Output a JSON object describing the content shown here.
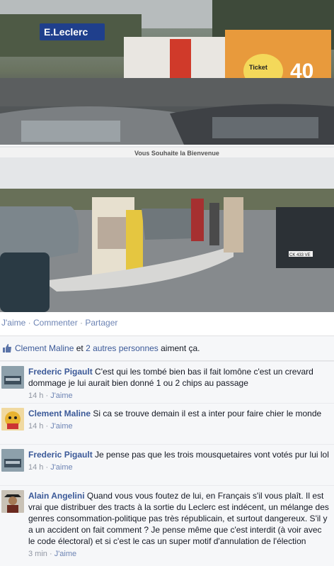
{
  "photos": {
    "photo1": {
      "store_sign": "E.Leclerc",
      "truck_text": "Ticket Leclerc",
      "truck_number": "40"
    },
    "photo2": {
      "banner_text": "Vous Souhaite la Bienvenue",
      "plate": "CK 433 VE"
    }
  },
  "post_actions": {
    "like": "J'aime",
    "comment": "Commenter",
    "share": "Partager"
  },
  "likes": {
    "name": "Clement Maline",
    "conj": " et ",
    "others": "2 autres personnes",
    "suffix": " aiment ça."
  },
  "comments": [
    {
      "author": "Frederic Pigault",
      "text": "C'est qui les tombé bien bas il fait lomône c'est un crevard dommage je lui aurait bien donné 1 ou 2 chips au passage",
      "time": "14 h",
      "like": "J'aime"
    },
    {
      "author": "Clement Maline",
      "text": "Si ca se trouve demain il est a inter pour faire chier le monde",
      "time": "14 h",
      "like": "J'aime"
    },
    {
      "author": "Frederic Pigault",
      "text": "Je pense pas que les trois mousquetaires vont votés pur lui lol",
      "time": "14 h",
      "like": "J'aime"
    },
    {
      "author": "Alain Angelini",
      "text": "Quand vous vous foutez de lui, en Français s'il vous plaît. Il est vrai que distribuer des tracts à la sortie du Leclerc est indécent, un mélange des genres consommation-politique pas très républicain, et surtout dangereux. S'il y a un accident on fait comment ? Je pense même que c'est interdit (à voir avec le code électoral) et si c'est le cas un super motif d'annulation de l'élection",
      "time": "3 min",
      "like": "J'aime"
    }
  ],
  "colors": {
    "link": "#3b5998",
    "meta": "#9197a3",
    "bg": "#f6f7f9"
  }
}
